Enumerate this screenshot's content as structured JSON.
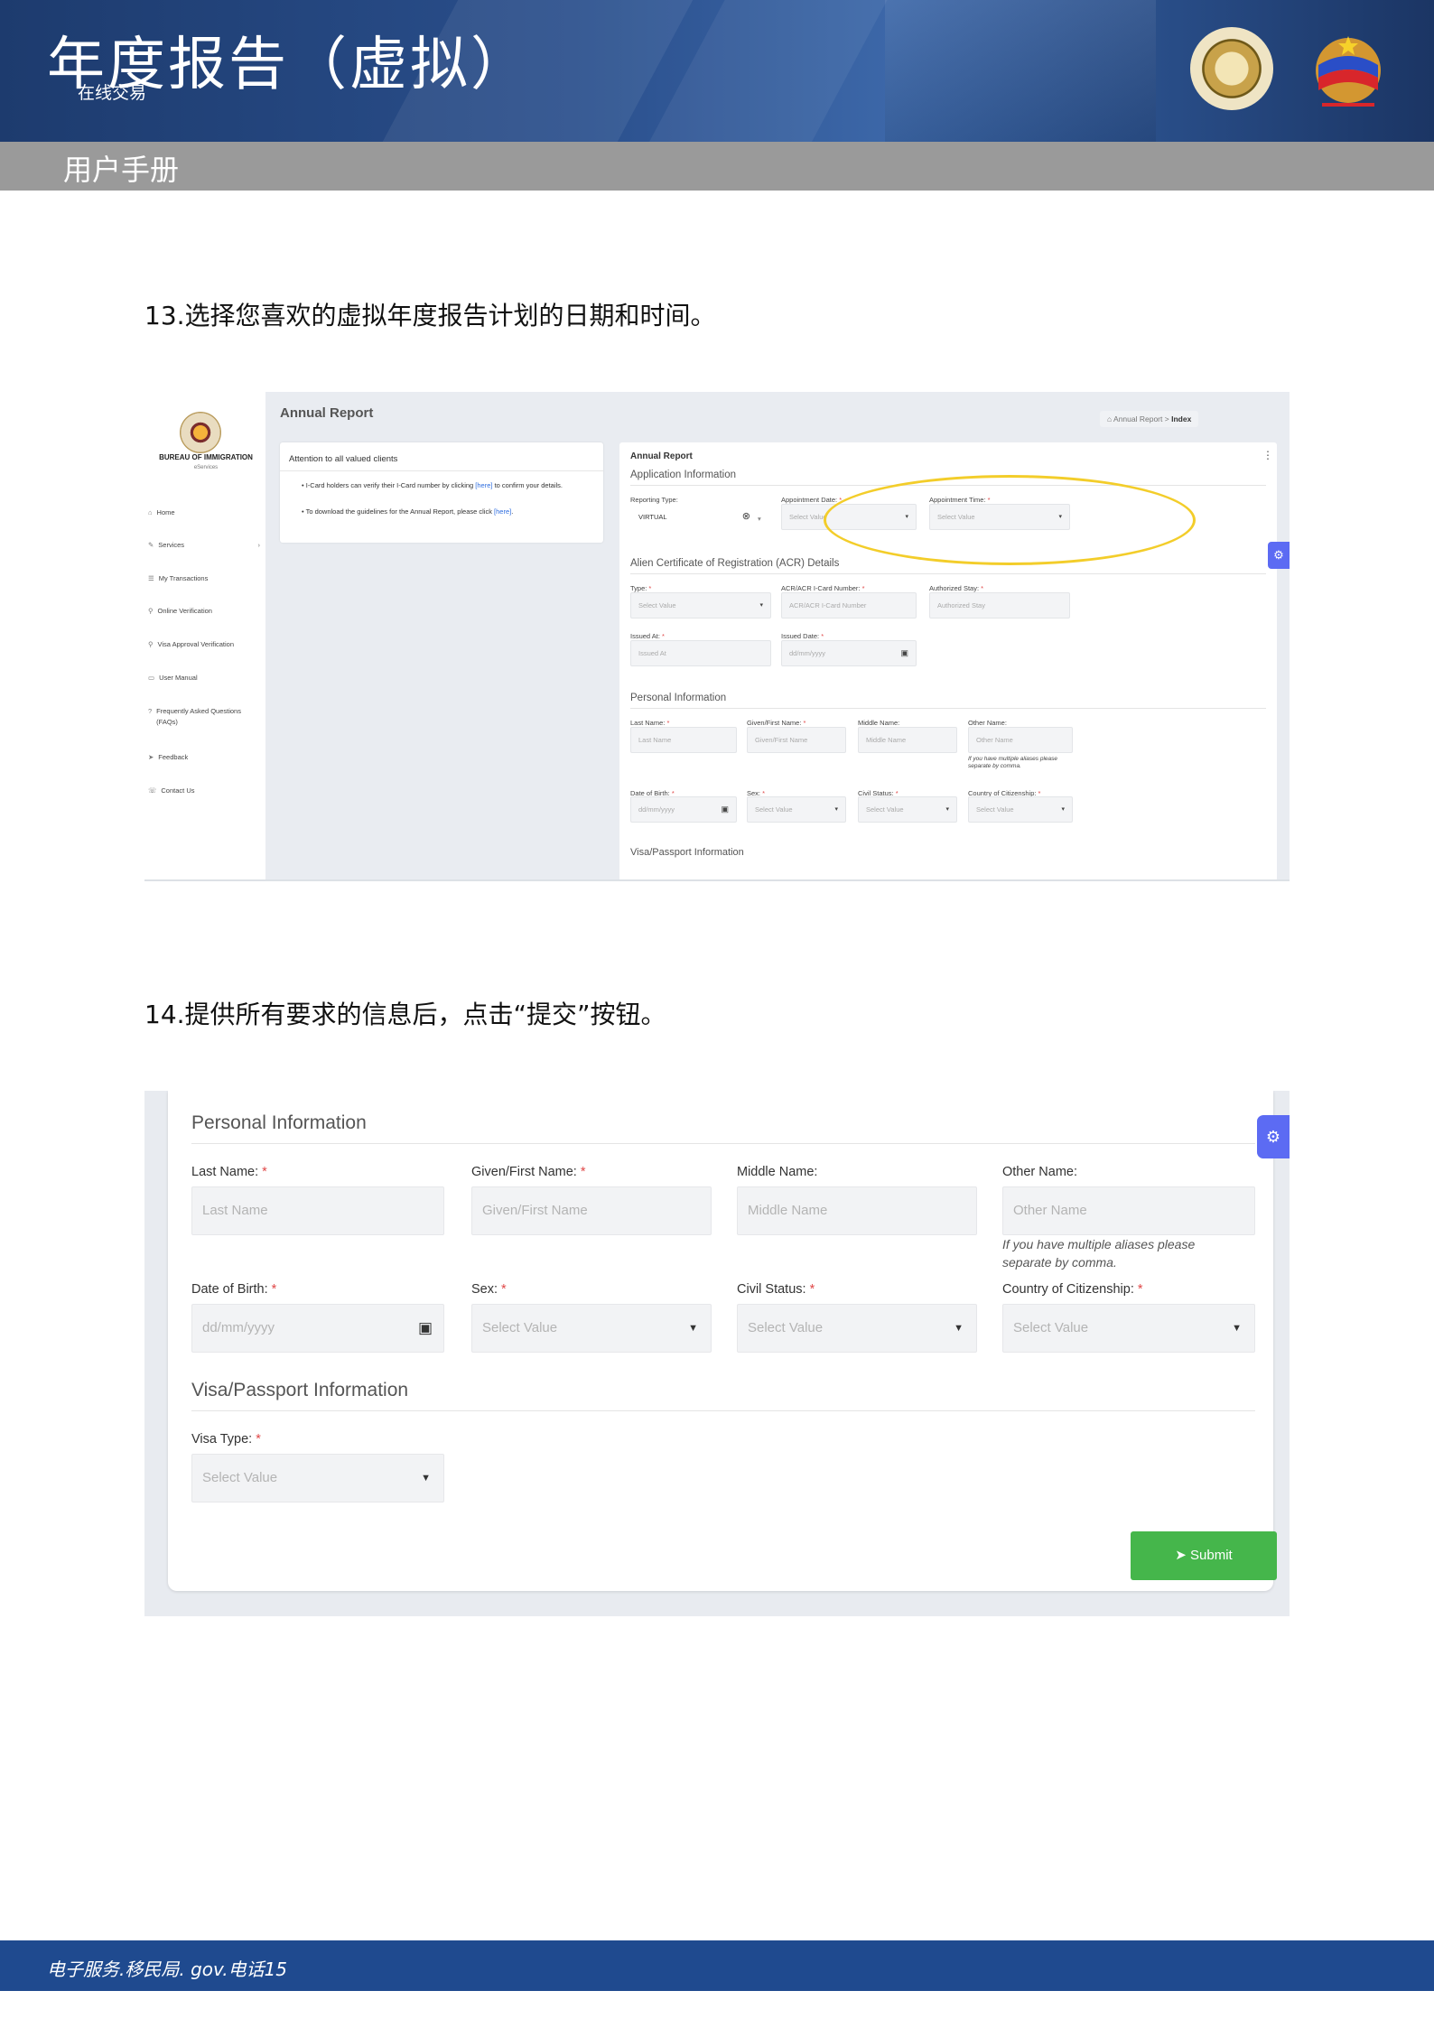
{
  "header": {
    "title": "年度报告（虚拟）",
    "subtitle": "在线交易",
    "section_bar": "用户手册",
    "colors": {
      "banner": "#2a4f8c",
      "bar": "#9a9a9a"
    }
  },
  "steps": {
    "step13": "13.选择您喜欢的虚拟年度报告计划的日期和时间。",
    "step14": "14.提供所有要求的信息后，点击“提交”按钮。"
  },
  "screenshot1": {
    "sidebar": {
      "bureau": "BUREAU OF IMMIGRATION",
      "eservices": "eServices",
      "items": [
        {
          "icon": "home-icon",
          "label": "Home"
        },
        {
          "icon": "edit-icon",
          "label": "Services"
        },
        {
          "icon": "list-icon",
          "label": "My Transactions"
        },
        {
          "icon": "search-icon",
          "label": "Online Verification"
        },
        {
          "icon": "search-icon",
          "label": "Visa Approval Verification"
        },
        {
          "icon": "book-icon",
          "label": "User Manual"
        },
        {
          "icon": "question-icon",
          "label": "Frequently Asked Questions (FAQs)"
        },
        {
          "icon": "send-icon",
          "label": "Feedback"
        },
        {
          "icon": "phone-icon",
          "label": "Contact Us"
        }
      ]
    },
    "page_title": "Annual Report",
    "breadcrumb": {
      "parent": "Annual Report",
      "sep": ">",
      "current": "Index"
    },
    "attention": {
      "title": "Attention to all valued clients",
      "item1_a": "I-Card holders can verify their I-Card number by clicking ",
      "item1_link": "[here]",
      "item1_b": " to confirm your details.",
      "item2_a": "To download the guidelines for the Annual Report, please click ",
      "item2_link": "[here]",
      "item2_b": "."
    },
    "form": {
      "title": "Annual Report",
      "app_info": "Application Information",
      "reporting_type_label": "Reporting Type:",
      "reporting_type_value": "VIRTUAL",
      "appt_date_label": "Appointment Date:",
      "appt_date_ph": "Select Value",
      "appt_time_label": "Appointment Time:",
      "appt_time_ph": "Select Value",
      "acr_section": "Alien Certificate of Registration (ACR) Details",
      "type_label": "Type:",
      "type_ph": "Select Value",
      "acr_label": "ACR/ACR I-Card Number:",
      "acr_ph": "ACR/ACR I-Card Number",
      "stay_label": "Authorized Stay:",
      "stay_ph": "Authorized Stay",
      "issued_at_label": "Issued At:",
      "issued_at_ph": "Issued At",
      "issued_date_label": "Issued Date:",
      "issued_date_ph": "dd/mm/yyyy",
      "personal": "Personal Information",
      "last_label": "Last Name:",
      "last_ph": "Last Name",
      "given_label": "Given/First Name:",
      "given_ph": "Given/First Name",
      "middle_label": "Middle Name:",
      "middle_ph": "Middle Name",
      "other_label": "Other Name:",
      "other_ph": "Other Name",
      "other_hint": "If you have multiple aliases please separate by comma.",
      "dob_label": "Date of Birth:",
      "dob_ph": "dd/mm/yyyy",
      "sex_label": "Sex:",
      "sex_ph": "Select Value",
      "civil_label": "Civil Status:",
      "civil_ph": "Select Value",
      "country_label": "Country of Citizenship:",
      "country_ph": "Select Value",
      "visa_section": "Visa/Passport Information"
    }
  },
  "screenshot2": {
    "personal": "Personal Information",
    "last_label": "Last Name:",
    "last_ph": "Last Name",
    "given_label": "Given/First Name:",
    "given_ph": "Given/First Name",
    "middle_label": "Middle Name:",
    "middle_ph": "Middle Name",
    "other_label": "Other Name:",
    "other_ph": "Other Name",
    "other_hint": "If you have multiple aliases please separate by comma.",
    "dob_label": "Date of Birth:",
    "dob_ph": "dd/mm/yyyy",
    "sex_label": "Sex:",
    "sex_ph": "Select Value",
    "civil_label": "Civil Status:",
    "civil_ph": "Select Value",
    "country_label": "Country of Citizenship:",
    "country_ph": "Select Value",
    "visa_section": "Visa/Passport Information",
    "visa_label": "Visa Type:",
    "visa_ph": "Select Value",
    "submit": "Submit",
    "colors": {
      "submit": "#45b64b",
      "settings_tab": "#5c6bf3"
    }
  },
  "footer": {
    "text": "电子服务.移民局. gov.电话15",
    "color": "#1f4a8f"
  }
}
